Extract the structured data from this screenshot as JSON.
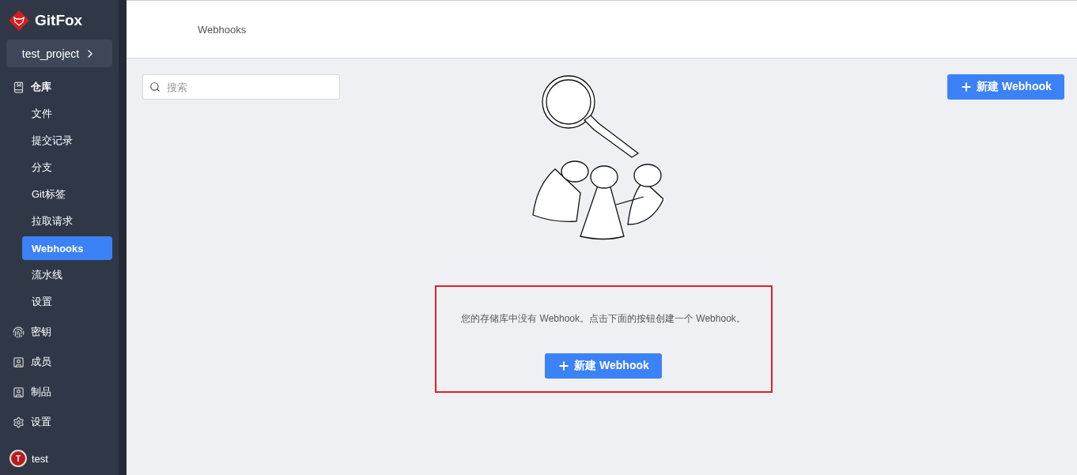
{
  "sidebar": {
    "logo": "GitFox",
    "project": "test_project",
    "sections": [
      {
        "label": "仓库",
        "expanded": true,
        "children": [
          {
            "label": "文件",
            "selected": false
          },
          {
            "label": "提交记录",
            "selected": false
          },
          {
            "label": "分支",
            "selected": false
          },
          {
            "label": "Git标签",
            "selected": false
          },
          {
            "label": "拉取请求",
            "selected": false
          },
          {
            "label": "Webhooks",
            "selected": true
          },
          {
            "label": "流水线",
            "selected": false
          },
          {
            "label": "设置",
            "selected": false
          }
        ]
      },
      {
        "label": "密钥",
        "expanded": false
      },
      {
        "label": "成员",
        "expanded": false
      },
      {
        "label": "制品",
        "expanded": false
      },
      {
        "label": "设置",
        "expanded": false
      }
    ],
    "user": {
      "initial": "T",
      "name": "test"
    }
  },
  "header": {
    "title": "Webhooks"
  },
  "toolbar": {
    "search": {
      "placeholder": "搜索"
    },
    "new_button": "新建 Webhook"
  },
  "empty_state": {
    "message": "您的存储库中没有 Webhook。点击下面的按钮创建一个 Webhook。",
    "button": "新建 Webhook"
  }
}
